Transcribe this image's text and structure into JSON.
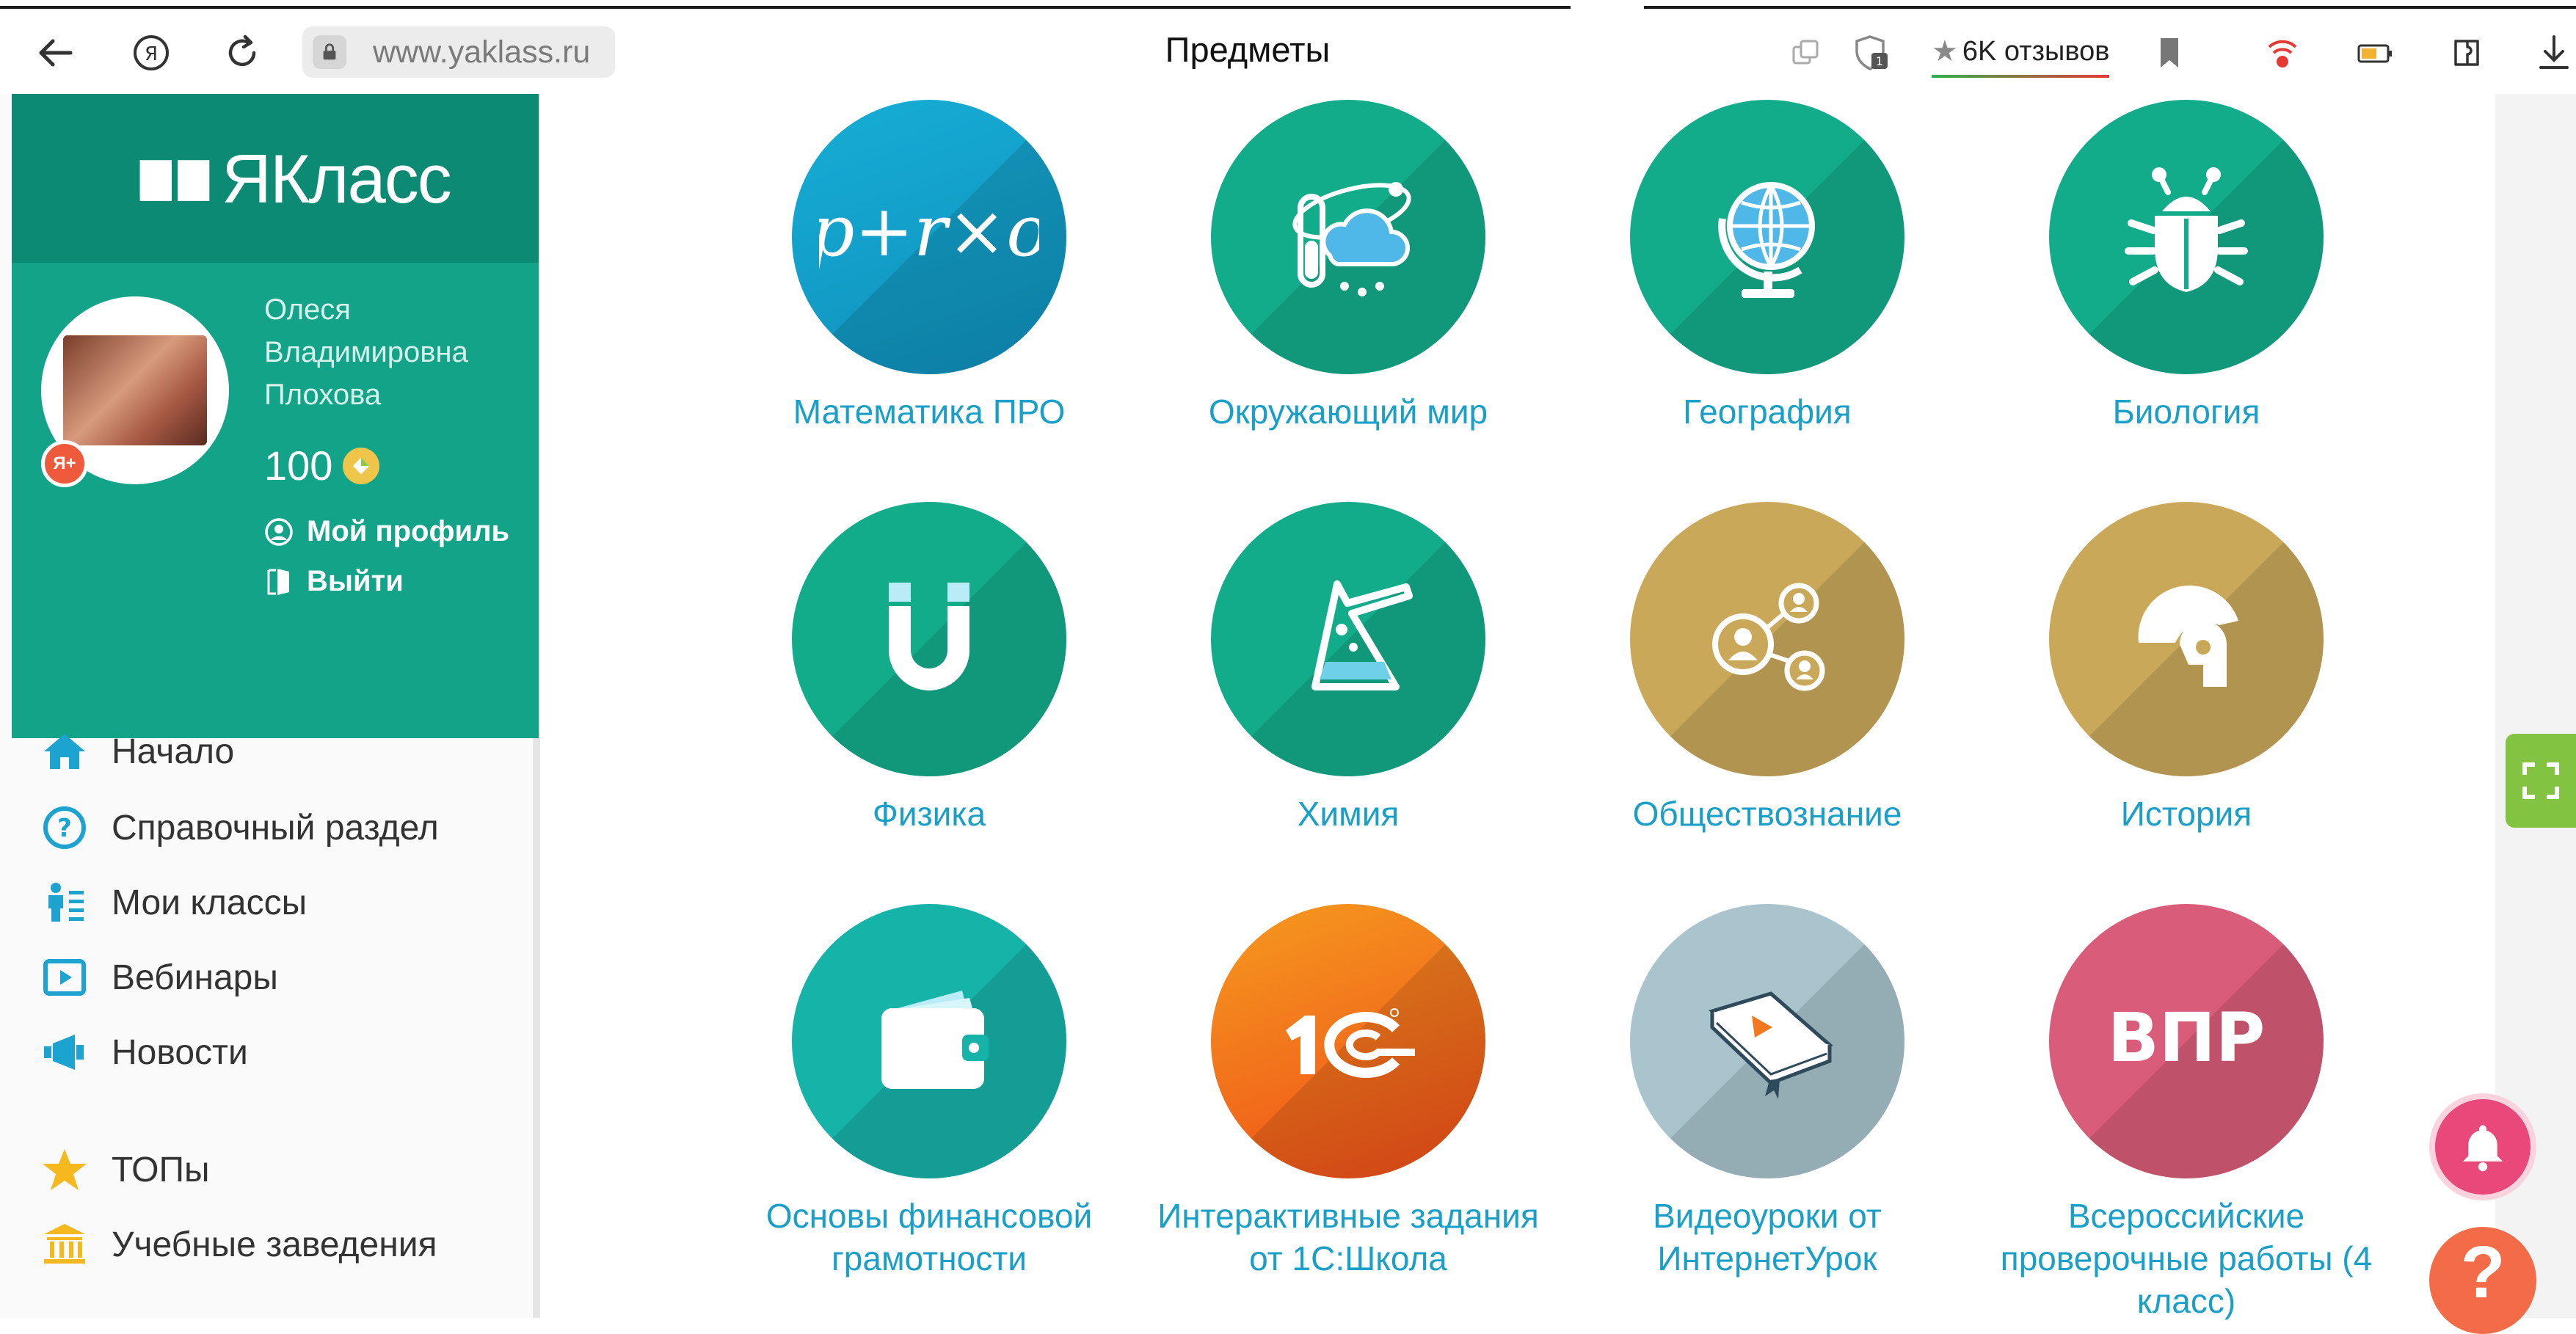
{
  "browser": {
    "url": "www.yaklass.ru",
    "page_title": "Предметы",
    "reviews_label": "6K отзывов"
  },
  "sidebar": {
    "logo_text": "ЯКласс",
    "profile": {
      "name_line1": "Олеся",
      "name_line2": "Владимировна",
      "name_line3": "Плохова",
      "points": "100",
      "badge": "Я+",
      "my_profile_label": "Мой профиль",
      "logout_label": "Выйти"
    },
    "nav": [
      {
        "label": "Начало",
        "icon": "home-icon"
      },
      {
        "label": "Справочный раздел",
        "icon": "help-circle-icon"
      },
      {
        "label": "Мои классы",
        "icon": "classes-icon"
      },
      {
        "label": "Вебинары",
        "icon": "play-icon"
      },
      {
        "label": "Новости",
        "icon": "megaphone-icon"
      },
      {
        "label": "ТОПы",
        "icon": "star-icon"
      },
      {
        "label": "Учебные заведения",
        "icon": "institution-icon"
      }
    ]
  },
  "subjects": [
    {
      "label": "Математика ПРО",
      "icon": "math-pro-icon",
      "color": "#16aed6"
    },
    {
      "label": "Окружающий мир",
      "icon": "world-around-icon",
      "color": "#13ac8a"
    },
    {
      "label": "География",
      "icon": "globe-icon",
      "color": "#13ac8a"
    },
    {
      "label": "Биология",
      "icon": "bug-icon",
      "color": "#13ac8a"
    },
    {
      "label": "Физика",
      "icon": "magnet-icon",
      "color": "#13ac8a"
    },
    {
      "label": "Химия",
      "icon": "flask-icon",
      "color": "#13ac8a"
    },
    {
      "label": "Обществознание",
      "icon": "people-network-icon",
      "color": "#c9a85a"
    },
    {
      "label": "История",
      "icon": "helmet-icon",
      "color": "#c9a85a"
    },
    {
      "label": "Основы финансовой грамотности",
      "icon": "wallet-icon",
      "color": "#16b3a8"
    },
    {
      "label": "Интерактивные задания от 1С:Школа",
      "icon": "1c-logo-icon",
      "color": "#f25c1a"
    },
    {
      "label": "Видеоуроки от ИнтернетУрок",
      "icon": "video-book-icon",
      "color": "#a9c4cd"
    },
    {
      "label": "Всероссийские проверочные работы (4 класс)",
      "icon": "vpr-icon",
      "color": "#d95c7a"
    }
  ],
  "vpr_text": "ВПР",
  "math_text": "p+r×o",
  "help_symbol": "?"
}
